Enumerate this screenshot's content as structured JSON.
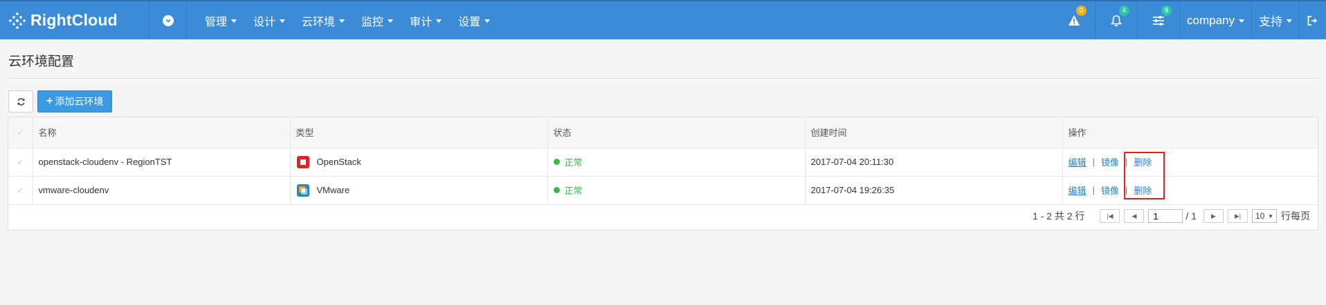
{
  "nav": {
    "brand": "RightCloud",
    "menu": [
      {
        "label": "管理"
      },
      {
        "label": "设计"
      },
      {
        "label": "云环境"
      },
      {
        "label": "监控"
      },
      {
        "label": "审计"
      },
      {
        "label": "设置"
      }
    ],
    "alerts_count": "0",
    "notifications_count": "4",
    "tasks_count": "9",
    "company": "company",
    "support": "支持",
    "colors": {
      "bar": "#3b8bd6",
      "alert_badge": "#f0ad1a",
      "info_badge": "#2ec4a5"
    }
  },
  "page": {
    "title": "云环境配置"
  },
  "toolbar": {
    "add_label": "添加云环境"
  },
  "table": {
    "headers": {
      "name": "名称",
      "type": "类型",
      "status": "状态",
      "created": "创建时间",
      "actions": "操作"
    },
    "rows": [
      {
        "name": "openstack-cloudenv - RegionTST",
        "type": "OpenStack",
        "type_icon": "openstack-icon",
        "status": "正常",
        "created": "2017-07-04 20:11:30",
        "edit": "编辑",
        "image": "镜像",
        "delete": "删除"
      },
      {
        "name": "vmware-cloudenv",
        "type": "VMware",
        "type_icon": "vmware-icon",
        "status": "正常",
        "created": "2017-07-04 19:26:35",
        "edit": "编辑",
        "image": "镜像",
        "delete": "删除"
      }
    ],
    "sep": "|"
  },
  "pager": {
    "summary": "1 - 2 共 2 行",
    "current_page": "1",
    "total_pages": "/ 1",
    "page_size": "10",
    "per_page_label": "行每页"
  }
}
